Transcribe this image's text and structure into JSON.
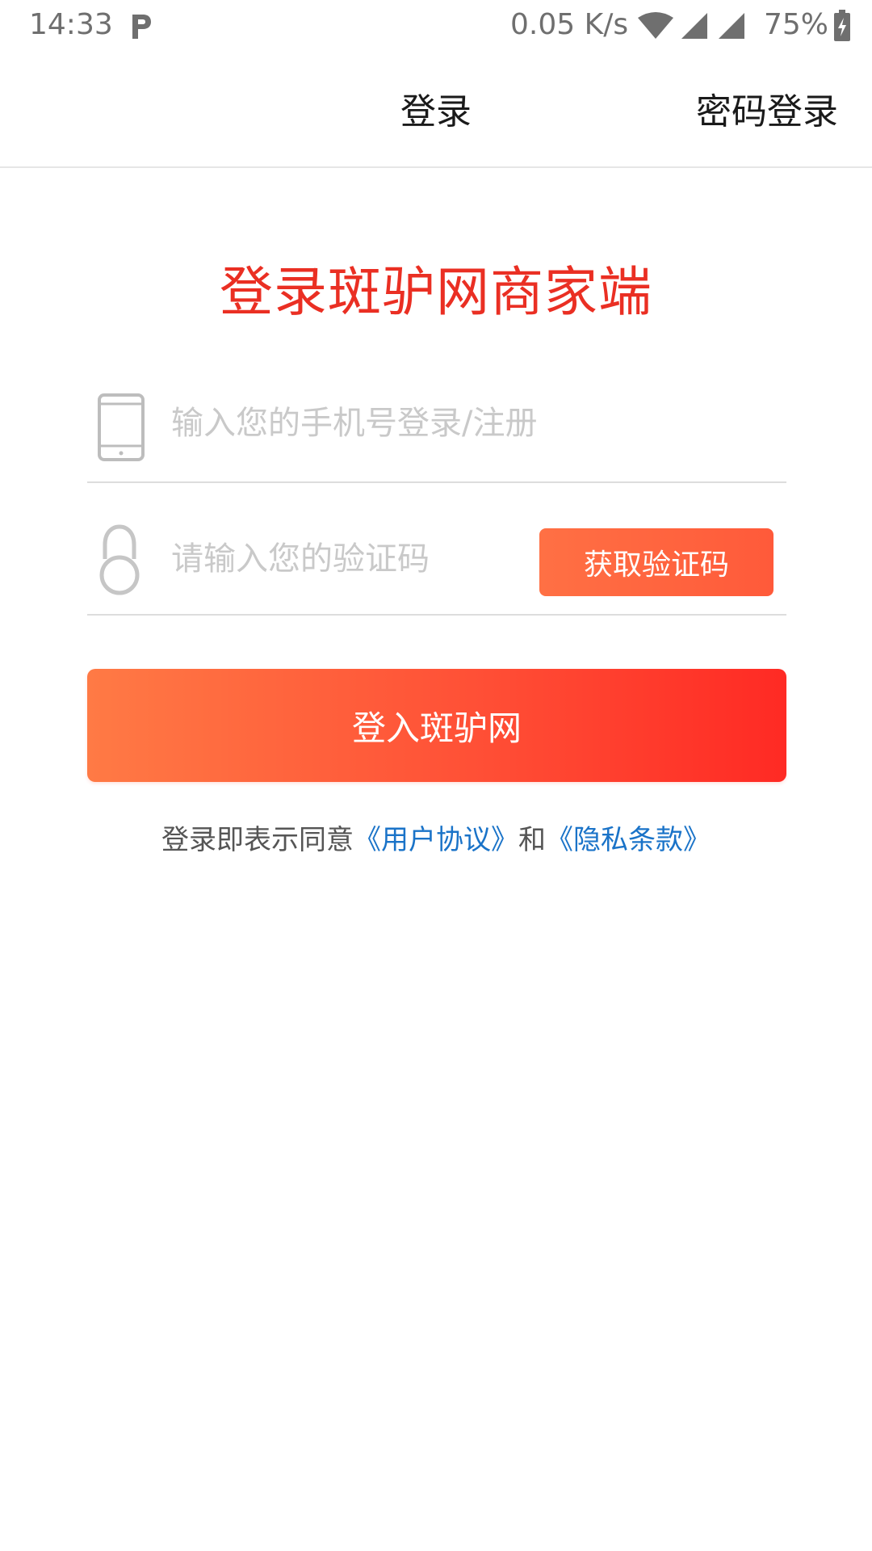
{
  "status_bar": {
    "time": "14:33",
    "network_speed": "0.05 K/s",
    "battery_percent": "75%",
    "icons": [
      "parking-app-icon",
      "wifi-icon",
      "signal-icon",
      "signal-icon",
      "battery-charging-icon"
    ]
  },
  "header": {
    "title": "登录",
    "action_label": "密码登录"
  },
  "main": {
    "title": "登录斑驴网商家端",
    "phone_placeholder": "输入您的手机号登录/注册",
    "code_placeholder": "请输入您的验证码",
    "get_code_label": "获取验证码",
    "login_button_label": "登入斑驴网"
  },
  "agreement": {
    "prefix": "登录即表示同意",
    "user_agreement": "《用户协议》",
    "conjunction": "和",
    "privacy_policy": "《隐私条款》"
  },
  "colors": {
    "title_red": "#ea2f23",
    "button_gradient_start": "#ff7a45",
    "button_gradient_end": "#ff2a24",
    "link_blue": "#1a73c8"
  }
}
